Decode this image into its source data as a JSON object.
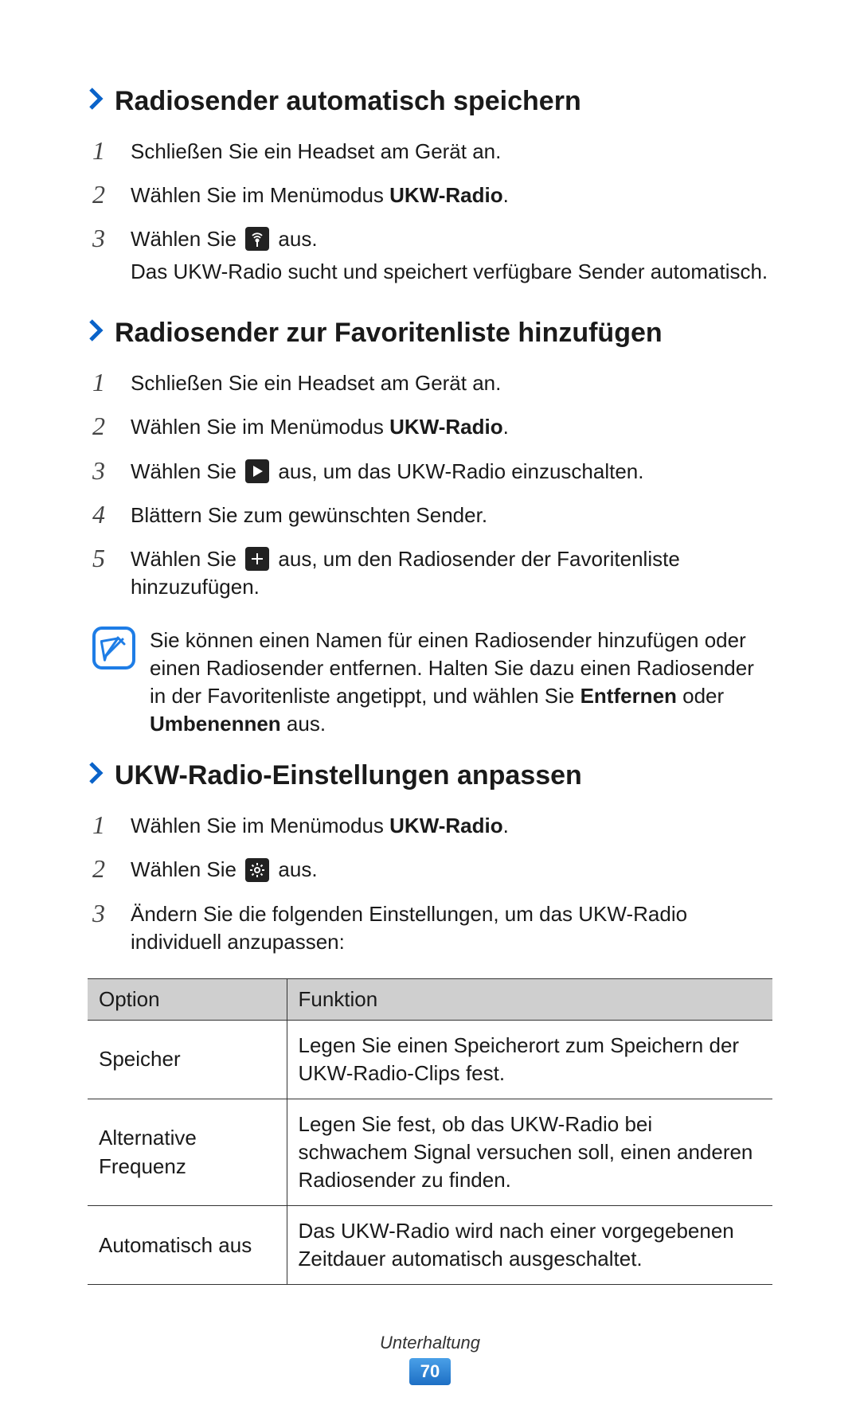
{
  "sections": [
    {
      "title": "Radiosender automatisch speichern",
      "steps": [
        {
          "num": "1",
          "text_parts": [
            {
              "t": "Schließen Sie ein Headset am Gerät an."
            }
          ]
        },
        {
          "num": "2",
          "text_parts": [
            {
              "t": "Wählen Sie im Menümodus "
            },
            {
              "t": "UKW-Radio",
              "bold": true
            },
            {
              "t": "."
            }
          ]
        },
        {
          "num": "3",
          "text_parts": [
            {
              "t": "Wählen Sie "
            },
            {
              "icon": "antenna"
            },
            {
              "t": " aus."
            }
          ],
          "sub_parts": [
            {
              "t": "Das UKW-Radio sucht und speichert verfügbare Sender automatisch."
            }
          ]
        }
      ]
    },
    {
      "title": "Radiosender zur Favoritenliste hinzufügen",
      "steps": [
        {
          "num": "1",
          "text_parts": [
            {
              "t": "Schließen Sie ein Headset am Gerät an."
            }
          ]
        },
        {
          "num": "2",
          "text_parts": [
            {
              "t": "Wählen Sie im Menümodus "
            },
            {
              "t": "UKW-Radio",
              "bold": true
            },
            {
              "t": "."
            }
          ]
        },
        {
          "num": "3",
          "text_parts": [
            {
              "t": "Wählen Sie "
            },
            {
              "icon": "play"
            },
            {
              "t": " aus, um das UKW-Radio einzuschalten."
            }
          ]
        },
        {
          "num": "4",
          "text_parts": [
            {
              "t": "Blättern Sie zum gewünschten Sender."
            }
          ]
        },
        {
          "num": "5",
          "text_parts": [
            {
              "t": "Wählen Sie "
            },
            {
              "icon": "plus"
            },
            {
              "t": " aus, um den Radiosender der Favoritenliste hinzuzufügen."
            }
          ]
        }
      ],
      "note_parts": [
        {
          "t": "Sie können einen Namen für einen Radiosender hinzufügen oder einen Radiosender entfernen. Halten Sie dazu einen Radiosender in der Favoritenliste angetippt, und wählen Sie "
        },
        {
          "t": "Entfernen",
          "bold": true
        },
        {
          "t": " oder "
        },
        {
          "t": "Umbenennen",
          "bold": true
        },
        {
          "t": " aus."
        }
      ]
    },
    {
      "title": "UKW-Radio-Einstellungen anpassen",
      "steps": [
        {
          "num": "1",
          "text_parts": [
            {
              "t": "Wählen Sie im Menümodus "
            },
            {
              "t": "UKW-Radio",
              "bold": true
            },
            {
              "t": "."
            }
          ]
        },
        {
          "num": "2",
          "text_parts": [
            {
              "t": "Wählen Sie "
            },
            {
              "icon": "gear"
            },
            {
              "t": " aus."
            }
          ]
        },
        {
          "num": "3",
          "text_parts": [
            {
              "t": "Ändern Sie die folgenden Einstellungen, um das UKW-Radio individuell anzupassen:"
            }
          ]
        }
      ],
      "table": {
        "headers": [
          "Option",
          "Funktion"
        ],
        "rows": [
          [
            "Speicher",
            "Legen Sie einen Speicherort zum Speichern der UKW-Radio-Clips fest."
          ],
          [
            "Alternative Frequenz",
            "Legen Sie fest, ob das UKW-Radio bei schwachem Signal versuchen soll, einen anderen Radiosender zu finden."
          ],
          [
            "Automatisch aus",
            "Das UKW-Radio wird nach einer vorgegebenen Zeitdauer automatisch ausgeschaltet."
          ]
        ]
      }
    }
  ],
  "footer": {
    "category": "Unterhaltung",
    "page": "70"
  }
}
